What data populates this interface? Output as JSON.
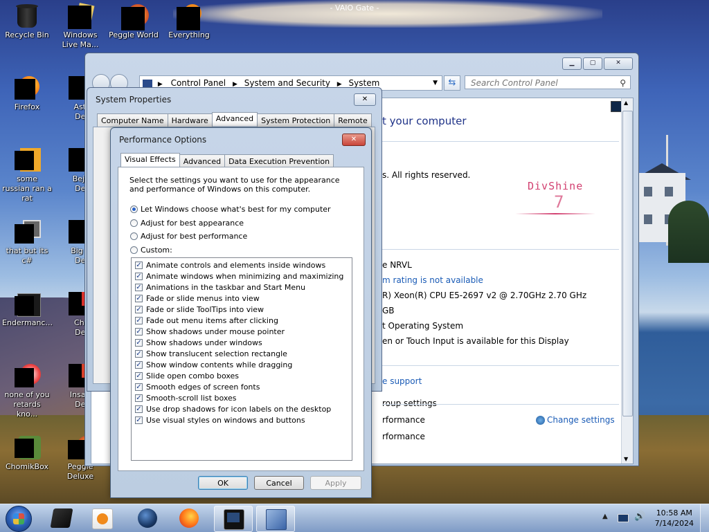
{
  "desktop": {
    "window_title": "- VAIO Gate -",
    "icons": [
      {
        "label": "Recycle Bin"
      },
      {
        "label": "Windows Live Ma..."
      },
      {
        "label": "Peggle World"
      },
      {
        "label": "Everything"
      },
      {
        "label": "Firefox"
      },
      {
        "label": "Astro... Delu..."
      },
      {
        "label": "some russian ran a rat"
      },
      {
        "label": "Bejew... Delu..."
      },
      {
        "label": "that but its c#"
      },
      {
        "label": "Big Mo... Delu..."
      },
      {
        "label": "Endermanc..."
      },
      {
        "label": "Chuz... Delu..."
      },
      {
        "label": "none of you retards kno..."
      },
      {
        "label": "Insaniq... Delu..."
      },
      {
        "label": "ChomikBox"
      },
      {
        "label": "Peggle Deluxe"
      }
    ]
  },
  "control_panel": {
    "breadcrumb": [
      "Control Panel",
      "System and Security",
      "System"
    ],
    "search_placeholder": "Search Control Panel",
    "heading_partial": "t your computer",
    "rights": "s.  All rights reserved.",
    "logo_text": "DivShine",
    "logo_num": "7",
    "computer_name_partial": "e NRVL",
    "rating_link": "m rating is not available",
    "processor": "R) Xeon(R) CPU E5-2697 v2 @ 2.70GHz   2.70 GHz",
    "memory": "GB",
    "system_type": "t Operating System",
    "pen_touch": "en or Touch Input is available for this Display",
    "support_link": "e support",
    "group_settings": "roup settings",
    "row1": "rformance",
    "row2": "rformance",
    "change_settings": "Change settings"
  },
  "system_properties": {
    "title": "System Properties",
    "tabs": [
      "Computer Name",
      "Hardware",
      "Advanced",
      "System Protection",
      "Remote"
    ],
    "active_tab": "Advanced"
  },
  "performance_options": {
    "title": "Performance Options",
    "tabs": [
      "Visual Effects",
      "Advanced",
      "Data Execution Prevention"
    ],
    "active_tab": "Visual Effects",
    "description": "Select the settings you want to use for the appearance and performance of Windows on this computer.",
    "radios": [
      {
        "label": "Let Windows choose what's best for my computer",
        "selected": true
      },
      {
        "label": "Adjust for best appearance",
        "selected": false
      },
      {
        "label": "Adjust for best performance",
        "selected": false
      },
      {
        "label": "Custom:",
        "selected": false
      }
    ],
    "options": [
      {
        "label": "Animate controls and elements inside windows",
        "checked": true
      },
      {
        "label": "Animate windows when minimizing and maximizing",
        "checked": true
      },
      {
        "label": "Animations in the taskbar and Start Menu",
        "checked": true
      },
      {
        "label": "Fade or slide menus into view",
        "checked": true
      },
      {
        "label": "Fade or slide ToolTips into view",
        "checked": true
      },
      {
        "label": "Fade out menu items after clicking",
        "checked": true
      },
      {
        "label": "Show shadows under mouse pointer",
        "checked": true
      },
      {
        "label": "Show shadows under windows",
        "checked": true
      },
      {
        "label": "Show translucent selection rectangle",
        "checked": true
      },
      {
        "label": "Show window contents while dragging",
        "checked": true
      },
      {
        "label": "Slide open combo boxes",
        "checked": true
      },
      {
        "label": "Smooth edges of screen fonts",
        "checked": true
      },
      {
        "label": "Smooth-scroll list boxes",
        "checked": true
      },
      {
        "label": "Use drop shadows for icon labels on the desktop",
        "checked": true
      },
      {
        "label": "Use visual styles on windows and buttons",
        "checked": true
      }
    ],
    "buttons": {
      "ok": "OK",
      "cancel": "Cancel",
      "apply": "Apply"
    }
  },
  "taskbar": {
    "time": "10:58 AM",
    "date": "7/14/2024"
  },
  "colors": {
    "accent_link": "#1a5bb6",
    "logo": "#d24070",
    "close_red": "#c9453a"
  }
}
